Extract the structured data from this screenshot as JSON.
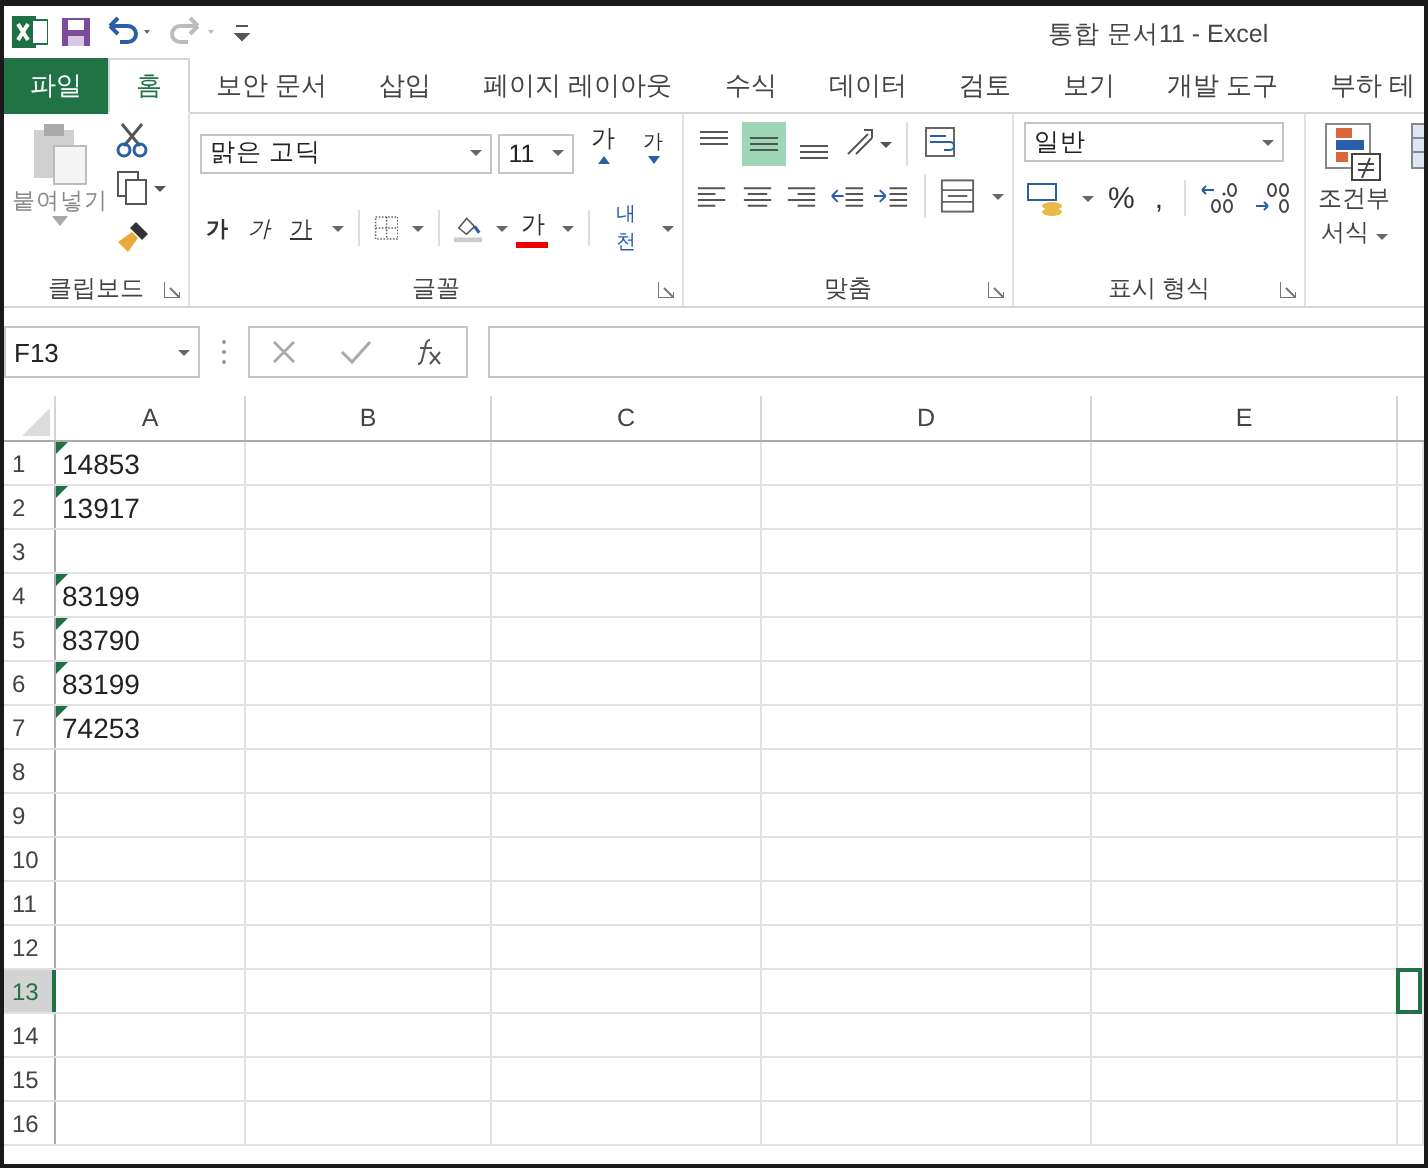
{
  "window": {
    "title": "통합 문서11 - Excel"
  },
  "tabs": [
    {
      "label": "파일",
      "kind": "file",
      "selected": false
    },
    {
      "label": "홈",
      "kind": "tab",
      "selected": true
    },
    {
      "label": "보안 문서",
      "kind": "tab",
      "selected": false
    },
    {
      "label": "삽입",
      "kind": "tab",
      "selected": false
    },
    {
      "label": "페이지 레이아웃",
      "kind": "tab",
      "selected": false
    },
    {
      "label": "수식",
      "kind": "tab",
      "selected": false
    },
    {
      "label": "데이터",
      "kind": "tab",
      "selected": false
    },
    {
      "label": "검토",
      "kind": "tab",
      "selected": false
    },
    {
      "label": "보기",
      "kind": "tab",
      "selected": false
    },
    {
      "label": "개발 도구",
      "kind": "tab",
      "selected": false
    },
    {
      "label": "부하 테",
      "kind": "tab",
      "selected": false
    }
  ],
  "ribbon": {
    "clipboard": {
      "label": "클립보드",
      "paste": "붙여넣기"
    },
    "font": {
      "label": "글꼴",
      "font_name": "맑은 고딕",
      "font_size": "11",
      "grow": "가",
      "shrink": "가",
      "bold": "가",
      "italic": "가",
      "underline": "가",
      "font_color": "가",
      "phonetic": "내천"
    },
    "alignment": {
      "label": "맞춤",
      "middle_align_selected": true
    },
    "number": {
      "label": "표시 형식",
      "format": "일반",
      "percent": "%",
      "comma": ","
    },
    "styles": {
      "conditional_line1": "조건부",
      "conditional_line2": "서식"
    }
  },
  "name_box": "F13",
  "columns": [
    "A",
    "B",
    "C",
    "D",
    "E"
  ],
  "rows": [
    {
      "header": "1",
      "a": "14853",
      "error_flag": true,
      "selected": false
    },
    {
      "header": "2",
      "a": "13917",
      "error_flag": true,
      "selected": false
    },
    {
      "header": "3",
      "a": "",
      "error_flag": false,
      "selected": false
    },
    {
      "header": "4",
      "a": "83199",
      "error_flag": true,
      "selected": false
    },
    {
      "header": "5",
      "a": "83790",
      "error_flag": true,
      "selected": false
    },
    {
      "header": "6",
      "a": "83199",
      "error_flag": true,
      "selected": false
    },
    {
      "header": "7",
      "a": "74253",
      "error_flag": true,
      "selected": false
    },
    {
      "header": "8",
      "a": "",
      "error_flag": false,
      "selected": false
    },
    {
      "header": "9",
      "a": "",
      "error_flag": false,
      "selected": false
    },
    {
      "header": "10",
      "a": "",
      "error_flag": false,
      "selected": false
    },
    {
      "header": "11",
      "a": "",
      "error_flag": false,
      "selected": false
    },
    {
      "header": "12",
      "a": "",
      "error_flag": false,
      "selected": false
    },
    {
      "header": "13",
      "a": "",
      "error_flag": false,
      "selected": true
    },
    {
      "header": "14",
      "a": "",
      "error_flag": false,
      "selected": false
    },
    {
      "header": "15",
      "a": "",
      "error_flag": false,
      "selected": false
    },
    {
      "header": "16",
      "a": "",
      "error_flag": false,
      "selected": false
    }
  ]
}
